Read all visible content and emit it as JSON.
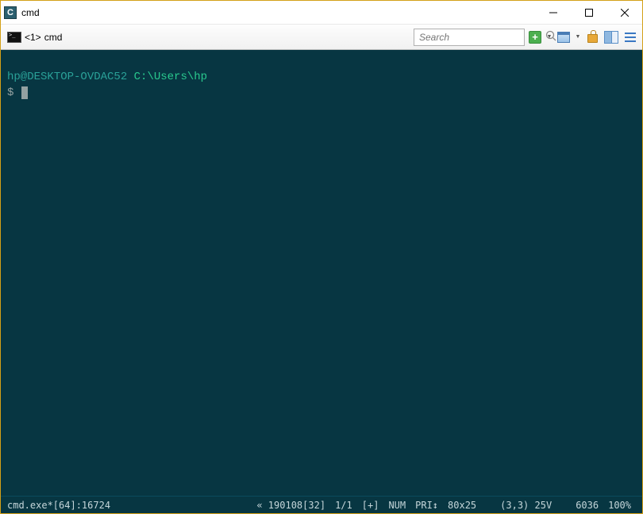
{
  "titlebar": {
    "title": "cmd"
  },
  "toolbar": {
    "tab": {
      "index": "<1>",
      "label": "cmd"
    },
    "search_placeholder": "Search"
  },
  "terminal": {
    "user_host": "hp@DESKTOP-OVDAC52",
    "path": "C:\\Users\\hp",
    "prompt": "$"
  },
  "statusbar": {
    "process": "cmd.exe*[64]:16724",
    "build": "« 190108[32]",
    "pages": "1/1",
    "insert": "[+]",
    "num": "NUM",
    "pri": "PRI↕",
    "size": "80x25",
    "cursor": "(3,3) 25V",
    "pid": "6036",
    "zoom": "100%"
  }
}
